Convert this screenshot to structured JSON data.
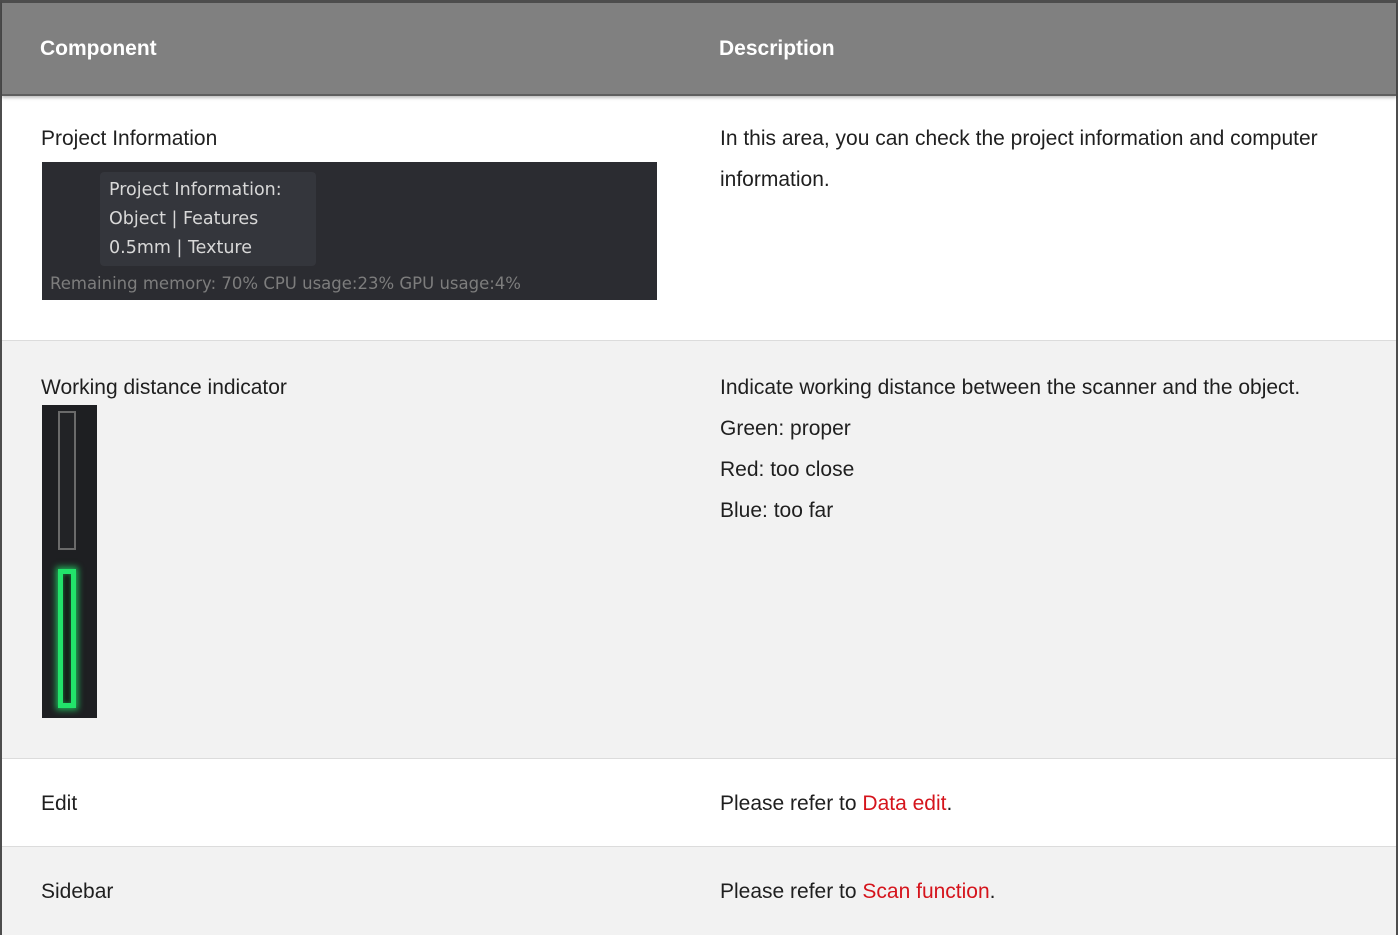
{
  "table": {
    "headers": {
      "component": "Component",
      "description": "Description"
    },
    "rows": [
      {
        "component": "Project Information",
        "description": "In this area, you can check the project information and computer information.",
        "screenshot": {
          "lines": [
            "Project Information:",
            "Object | Features",
            "0.5mm | Texture"
          ],
          "status": "Remaining memory: 70% CPU usage:23%  GPU usage:4%"
        }
      },
      {
        "component": "Working distance indicator",
        "description": "Indicate working distance between the scanner and the object.",
        "legend": [
          "Green: proper",
          "Red: too close",
          "Blue: too far"
        ],
        "indicator": {
          "active_segment": "bottom",
          "active_color": "#22e36a"
        }
      },
      {
        "component": "Edit",
        "description_prefix": "Please refer to ",
        "link_text": "Data edit",
        "description_suffix": "."
      },
      {
        "component": "Sidebar",
        "description_prefix": "Please refer to ",
        "link_text": "Scan function",
        "description_suffix": "."
      }
    ]
  },
  "colors": {
    "header_bg": "#808080",
    "header_text": "#ffffff",
    "row_alt_bg": "#f2f2f2",
    "link": "#d5141c"
  }
}
